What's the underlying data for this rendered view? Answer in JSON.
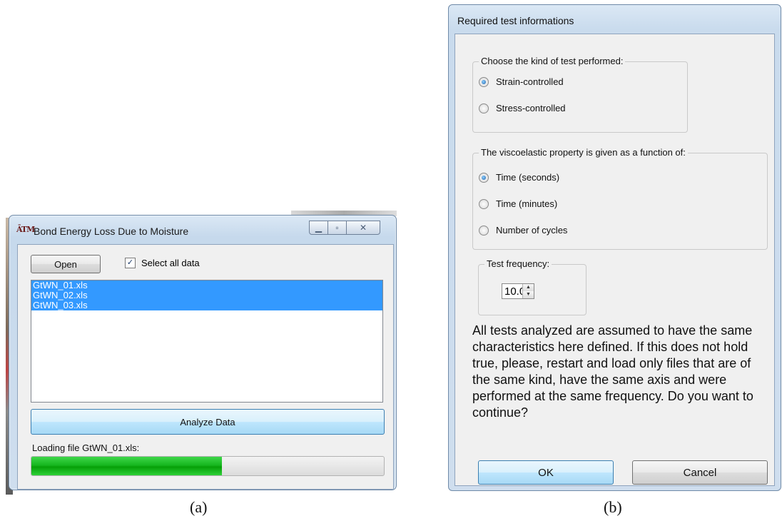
{
  "window_a": {
    "title": "Bond Energy Loss Due to Moisture",
    "logo_text": "ĀTM",
    "open_label": "Open",
    "select_all_label": "Select all data",
    "select_all_checked": true,
    "files": [
      "GtWN_01.xls",
      "GtWN_02.xls",
      "GtWN_03.xls"
    ],
    "analyze_label": "Analyze Data",
    "loading_text": "Loading file GtWN_01.xls:",
    "progress_fraction": 0.54,
    "caption": "(a)",
    "controls": {
      "minimize_icon": "minimize-icon",
      "maximize_icon": "maximize-icon",
      "close_icon": "close-icon"
    }
  },
  "window_b": {
    "title": "Required test informations",
    "group_test_kind": {
      "title": "Choose the kind of test performed:",
      "options": [
        "Strain-controlled",
        "Stress-controlled"
      ],
      "selected": 0
    },
    "group_property": {
      "title": "The viscoelastic property is given as a function of:",
      "options": [
        "Time (seconds)",
        "Time (minutes)",
        "Number of cycles"
      ],
      "selected": 0
    },
    "frequency": {
      "title": "Test frequency:",
      "value": "10.0"
    },
    "notice": "All tests analyzed are assumed to have the same characteristics here defined. If this does not hold true, please, restart and load only files that are of the same kind, have the same axis and were performed at the same frequency. Do you want to continue?",
    "ok_label": "OK",
    "cancel_label": "Cancel",
    "caption": "(b)"
  }
}
